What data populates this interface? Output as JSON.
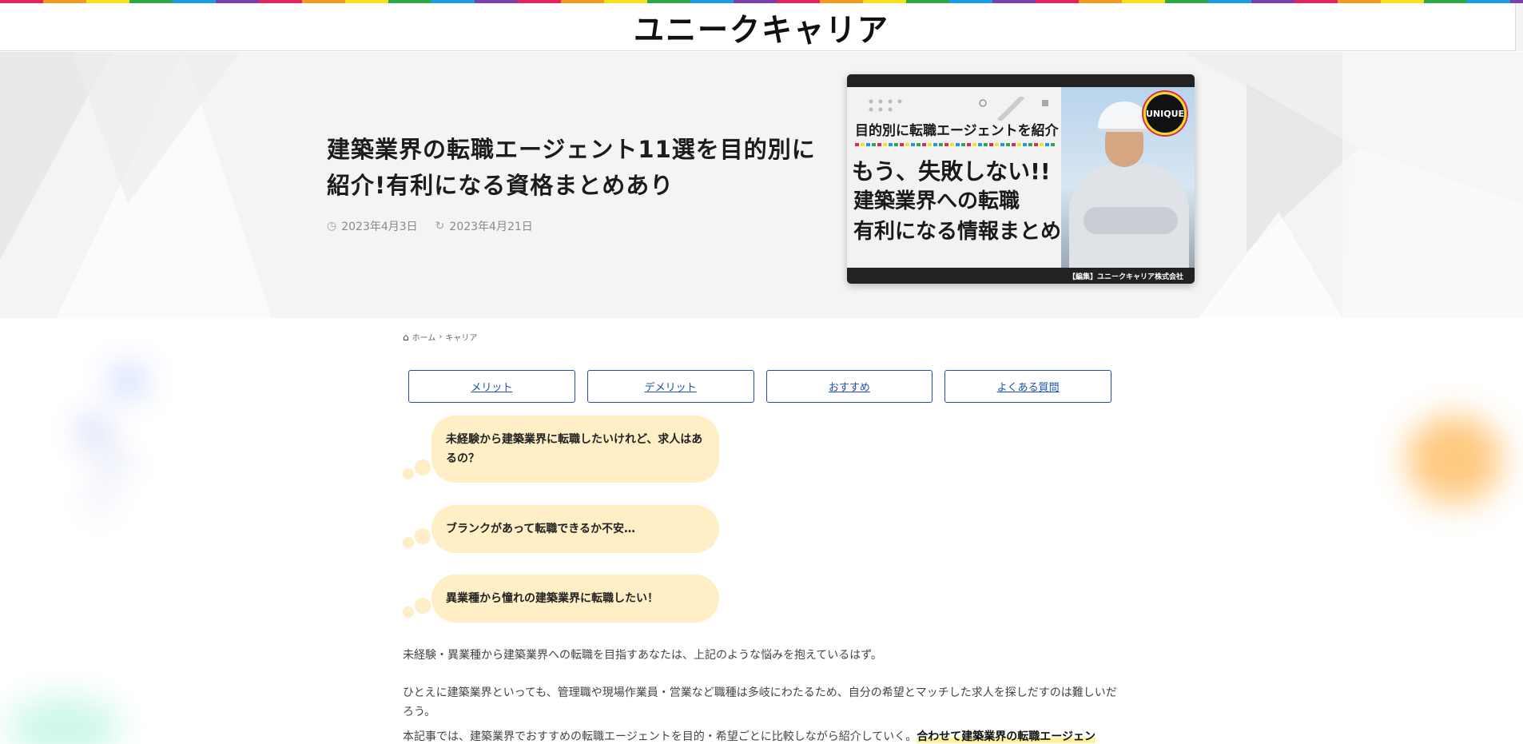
{
  "header": {
    "logo": "ユニークキャリア"
  },
  "hero": {
    "title": "建築業界の転職エージェント11選を目的別に紹介!有利になる資格まとめあり",
    "published_date": "2023年4月3日",
    "updated_date": "2023年4月21日",
    "thumbnail": {
      "badge": "UNIQUE",
      "line1": "目的別に転職エージェントを紹介",
      "line2": "もう、失敗しない!!",
      "line3": "建築業界への転職",
      "line4": "有利になる情報まとめ",
      "footer": "【編集】ユニークキャリア株式会社"
    }
  },
  "breadcrumb": {
    "home": "ホーム",
    "category": "キャリア"
  },
  "toc": [
    {
      "label": "メリット"
    },
    {
      "label": "デメリット"
    },
    {
      "label": "おすすめ"
    },
    {
      "label": "よくある質問"
    }
  ],
  "bubbles": [
    {
      "text": "未経験から建築業界に転職したいけれど、求人はあるの？"
    },
    {
      "text": "ブランクがあって転職できるか不安…"
    },
    {
      "text": "異業種から憧れの建築業界に転職したい！"
    }
  ],
  "paragraphs": {
    "p1": "未経験・異業種から建築業界への転職を目指すあなたは、上記のような悩みを抱えているはず。",
    "p2": "ひとえに建築業界といっても、管理職や現場作業員・営業など職種は多岐にわたるため、自分の希望とマッチした求人を探しだすのは難しいだろう。",
    "p3_plain": "本記事では、建築業界でおすすめの転職エージェントを目的・希望ごとに比較しながら紹介していく。",
    "p3_highlight": "合わせて建築業界の転職エージェン"
  },
  "icons": {
    "clock": "clock-icon",
    "refresh": "refresh-icon",
    "home": "home-icon",
    "chevron": "chevron-right-icon"
  },
  "colors": {
    "link": "#1b4fb0",
    "bubble": "#ffeec6",
    "highlight": "#fff39a"
  }
}
